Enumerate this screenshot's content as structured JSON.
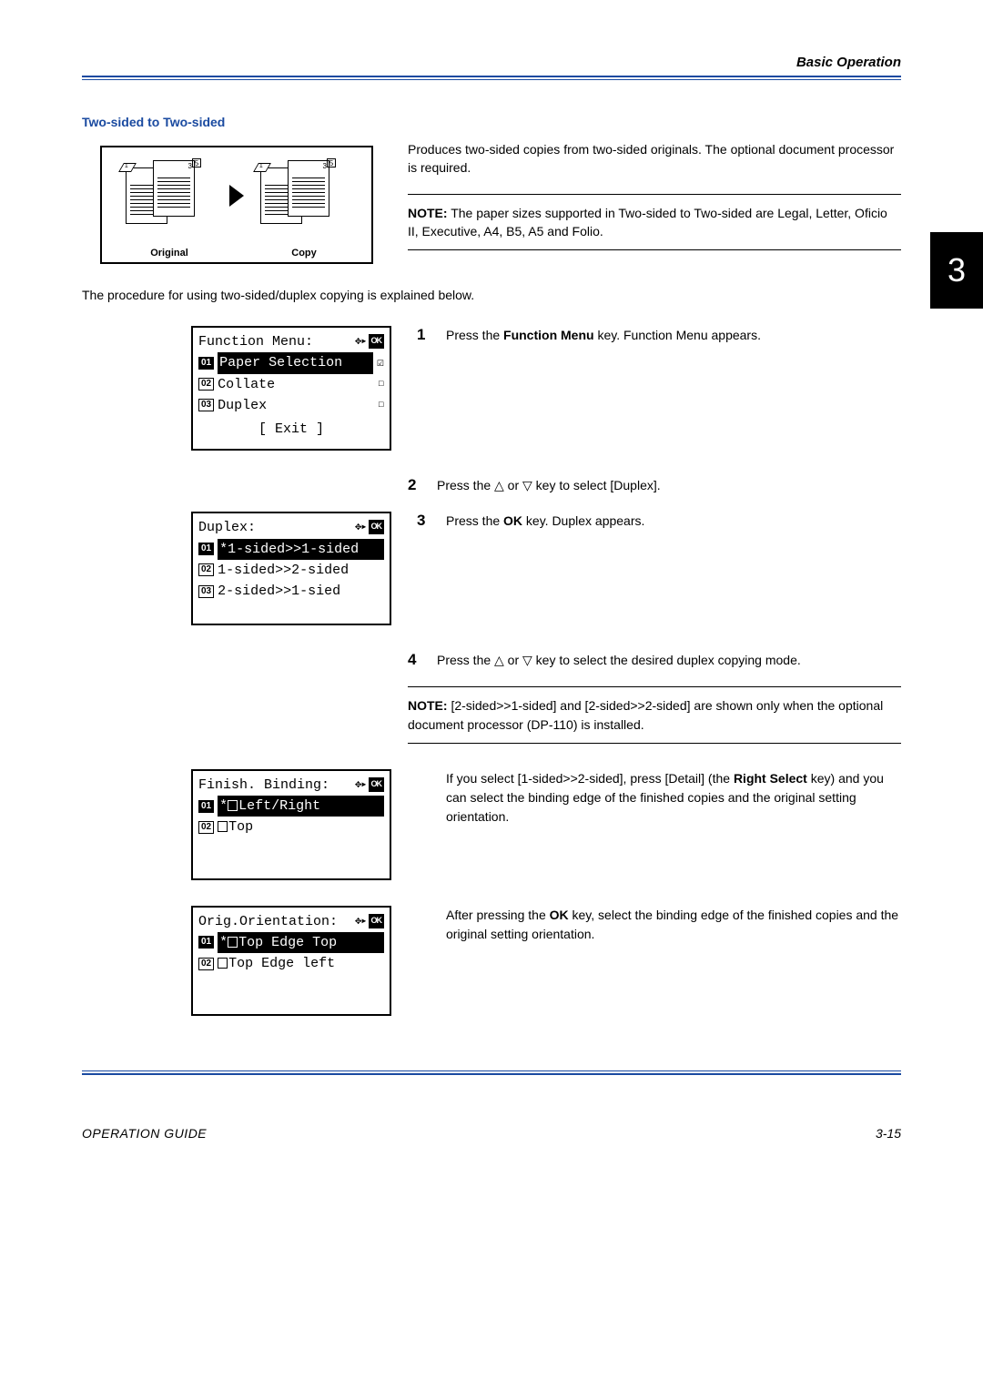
{
  "header": {
    "section": "Basic Operation"
  },
  "section_title": "Two-sided to Two-sided",
  "diagram": {
    "original_label": "Original",
    "copy_label": "Copy",
    "page_front_num": "3",
    "page_dup_num": "5",
    "fold_num": "1"
  },
  "intro_right": "Produces two-sided copies from two-sided originals. The optional document processor is required.",
  "note1_label": "NOTE:",
  "note1_text": " The paper sizes supported in Two-sided to Two-sided are Legal, Letter, Oficio II, Executive, A4, B5, A5 and Folio.",
  "body_line": "The procedure for using two-sided/duplex copying is explained below.",
  "lcd1": {
    "title": "Function Menu:",
    "row1_num": "01",
    "row1_text": "Paper Selection",
    "row2_num": "02",
    "row2_text": "Collate",
    "row3_num": "03",
    "row3_text": "Duplex",
    "exit": "[  Exit  ]"
  },
  "step1_num": "1",
  "step1_text_a": "Press the ",
  "step1_bold": "Function Menu",
  "step1_text_b": " key. Function Menu appears.",
  "step2_num": "2",
  "step2_text": "Press the △ or ▽ key to select [Duplex].",
  "lcd2": {
    "title": "Duplex:",
    "row1_num": "01",
    "row1_text": "*1-sided>>1-sided",
    "row2_num": "02",
    "row2_text": "1-sided>>2-sided",
    "row3_num": "03",
    "row3_text": "2-sided>>1-sied"
  },
  "step3_num": "3",
  "step3_text_a": "Press the ",
  "step3_bold": "OK",
  "step3_text_b": " key. Duplex appears.",
  "step4_num": "4",
  "step4_text": "Press the △ or ▽ key to select the desired duplex copying mode.",
  "note2_label": "NOTE:",
  "note2_text": " [2-sided>>1-sided] and [2-sided>>2-sided] are shown only when the optional document processor (DP-110) is installed.",
  "lcd3": {
    "title": "Finish. Binding:",
    "row1_num": "01",
    "row1_text": "Left/Right",
    "row2_num": "02",
    "row2_text": "Top"
  },
  "sel_text_a": "If you select [1-sided>>2-sided], press [Detail] (the ",
  "sel_bold": "Right Select",
  "sel_text_b": " key) and you can select the binding edge of the finished copies and the original setting orientation.",
  "lcd4": {
    "title": "Orig.Orientation:",
    "row1_num": "01",
    "row1_text": "Top Edge Top",
    "row2_num": "02",
    "row2_text": "Top Edge left"
  },
  "after_ok_a": "After pressing the ",
  "after_ok_bold": "OK",
  "after_ok_b": " key, select the binding edge of the finished copies and the original setting orientation.",
  "chapter_tab": "3",
  "footer": {
    "left": "OPERATION GUIDE",
    "right": "3-15"
  },
  "ok_badge": "OK"
}
